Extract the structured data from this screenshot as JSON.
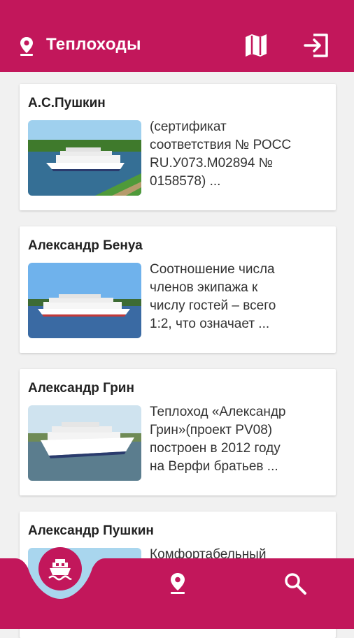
{
  "appbar": {
    "title": "Теплоходы",
    "icons": [
      "location-pin-icon",
      "map-icon",
      "logout-icon"
    ]
  },
  "colors": {
    "primary": "#c2175b",
    "background": "#f1f1f1"
  },
  "ships": [
    {
      "name": "А.С.Пушкин",
      "desc_lines": [
        "(сертификат",
        "соответствия № РОСС",
        "RU.У073.М02894 №",
        "0158578) ..."
      ]
    },
    {
      "name": "Александр Бенуа",
      "desc_lines": [
        "Соотношение числа",
        "членов экипажа к",
        "числу гостей – всего",
        "1:2, что означает ..."
      ]
    },
    {
      "name": "Александр Грин",
      "desc_lines": [
        "Теплоход «Александр",
        "Грин»(проект PV08)",
        "построен в 2012 году",
        "на Верфи братьев ..."
      ]
    },
    {
      "name": "Александр Пушкин",
      "desc_lines": [
        "Комфортабельный",
        "",
        "",
        ""
      ]
    }
  ],
  "bottom_nav": {
    "items": [
      "ship-icon",
      "location-pin-icon",
      "search-icon"
    ],
    "active": "ship-icon"
  }
}
